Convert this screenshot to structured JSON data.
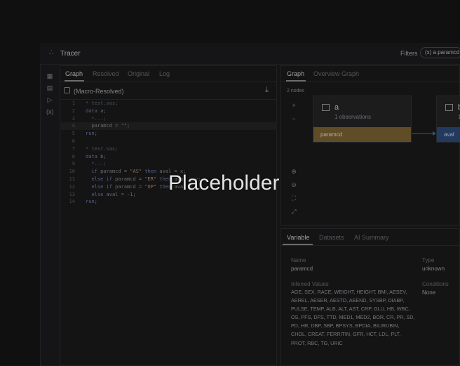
{
  "app": {
    "title": "Tracer",
    "filters_label": "Filters",
    "filter_chip": "(x) a.paramcd"
  },
  "rail": [
    "table-icon",
    "code-file-icon",
    "terminal-icon",
    "variable-icon"
  ],
  "left_pane": {
    "tabs": [
      "Graph",
      "Resolved",
      "Original",
      "Log"
    ],
    "active_tab": "Graph",
    "subheader": "(Macro-Resolved)",
    "code_lines": [
      {
        "n": "1",
        "text": "* test.sas;"
      },
      {
        "n": "2",
        "text": "data a;"
      },
      {
        "n": "3",
        "text": "  *...;"
      },
      {
        "n": "4",
        "text": "  paramcd = \"\";"
      },
      {
        "n": "5",
        "text": "run;"
      },
      {
        "n": "6",
        "text": ""
      },
      {
        "n": "7",
        "text": "* test.sas;"
      },
      {
        "n": "8",
        "text": "data b;"
      },
      {
        "n": "9",
        "text": "  *...;"
      },
      {
        "n": "10",
        "text": "  if paramcd = \"AS\" then aval = x;"
      },
      {
        "n": "11",
        "text": "  else if paramcd = \"ER\" then aval = y;"
      },
      {
        "n": "12",
        "text": "  else if paramcd = \"OP\" then aval = z;"
      },
      {
        "n": "13",
        "text": "  else aval = -1;"
      },
      {
        "n": "14",
        "text": "run;"
      }
    ],
    "highlight_line": "4"
  },
  "right_pane": {
    "tabs": [
      "Graph",
      "Overview Graph"
    ],
    "active_tab": "Graph",
    "nodes_count": "2 nodes",
    "node_a": {
      "title": "a",
      "subtitle": "1 observations",
      "row": "paramcd"
    },
    "node_b": {
      "title": "b",
      "subtitle": "1",
      "row": "aval"
    }
  },
  "details": {
    "tabs": [
      "Variable",
      "Datasets",
      "AI Summary"
    ],
    "active_tab": "Variable",
    "name_label": "Name",
    "name_value": "paramcd",
    "type_label": "Type",
    "type_value": "unknown",
    "inferred_label": "Inferred Values",
    "inferred_value": "AGE, SEX, RACE, WEIGHT, HEIGHT, BMI, AESEV, AEREL, AESER, AESTD, AEEND, SYSBP, DIABP, PULSE, TEMP, ALB, ALT, AST, CRP, GLU, HB, WBC, OS, PFS, DFS, TTD, MED1, MED2, BOR, CR, PR, SD, PD, HR, DBP, SBP, BPSYS, BPDIA, BILIRUBIN, CHOL, CREAT, FERRITIN, GFR, HCT, LDL, PLT, PROT, RBC, TG, URIC",
    "conditions_label": "Conditions",
    "conditions_value": "None"
  },
  "overlay": {
    "text": "Placeholder"
  },
  "colors": {
    "accent_gold": "#7a6332",
    "accent_blue": "#2d4a78",
    "edge": "#3d6bb0"
  }
}
